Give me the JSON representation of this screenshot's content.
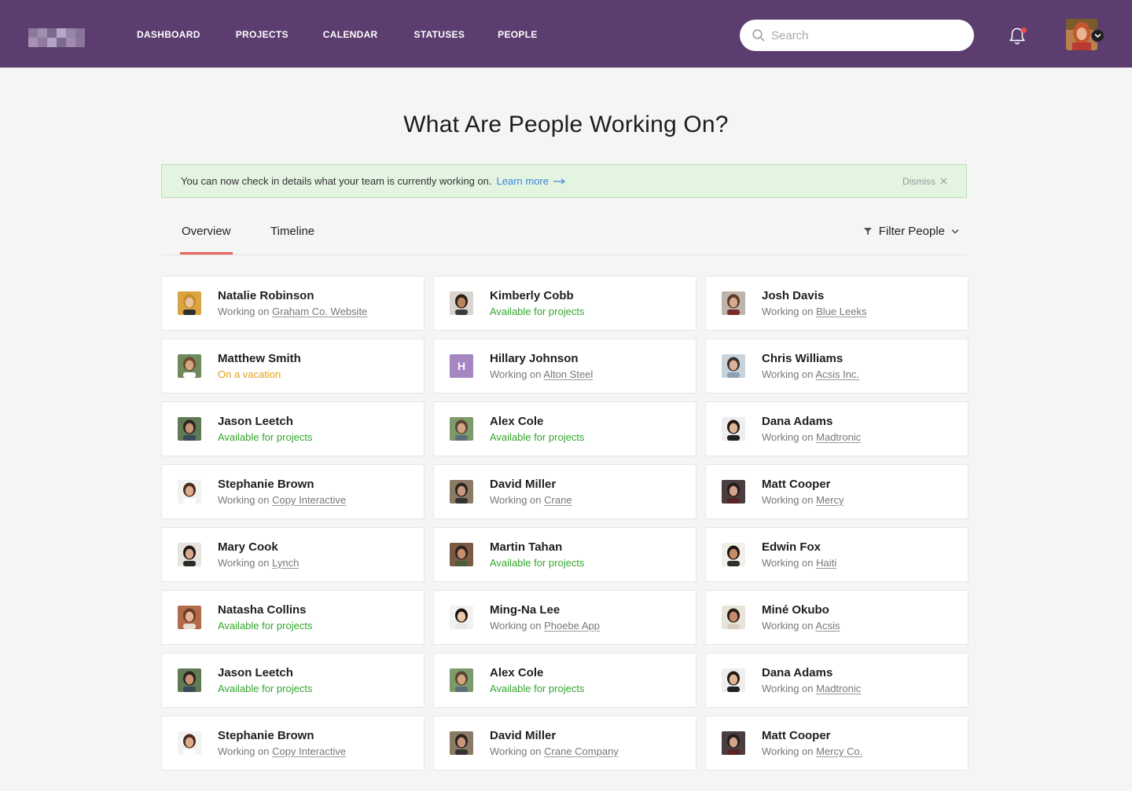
{
  "header": {
    "nav": [
      "DASHBOARD",
      "PROJECTS",
      "CALENDAR",
      "STATUSES",
      "PEOPLE"
    ],
    "search_placeholder": "Search",
    "brand_color": "#5b3d6f",
    "notification_dot_color": "#f04b4b"
  },
  "main": {
    "title": "What Are People Working On?",
    "banner": {
      "text": "You can now check in details what your team is currently working on.",
      "link": "Learn more",
      "dismiss": "Dismiss"
    },
    "tabs": [
      {
        "label": "Overview",
        "active": true
      },
      {
        "label": "Timeline",
        "active": false
      }
    ],
    "filter_label": "Filter People",
    "working_prefix": "Working on ",
    "people": [
      {
        "name": "Natalie Robinson",
        "status": "working",
        "project": "Graham Co. Website",
        "avatar": "photo-1"
      },
      {
        "name": "Kimberly Cobb",
        "status": "available",
        "text": "Available for projects",
        "avatar": "photo-2"
      },
      {
        "name": "Josh Davis",
        "status": "working",
        "project": "Blue Leeks",
        "avatar": "photo-3"
      },
      {
        "name": "Matthew Smith",
        "status": "vacation",
        "text": "On a vacation",
        "avatar": "photo-4"
      },
      {
        "name": "Hillary Johnson",
        "status": "working",
        "project": "Alton Steel",
        "avatar": "letter",
        "initial": "H"
      },
      {
        "name": "Chris Williams",
        "status": "working",
        "project": "Acsis Inc.",
        "avatar": "photo-5"
      },
      {
        "name": "Jason Leetch",
        "status": "available",
        "text": "Available for projects",
        "avatar": "photo-6"
      },
      {
        "name": "Alex Cole",
        "status": "available",
        "text": "Available for projects",
        "avatar": "photo-7"
      },
      {
        "name": "Dana Adams",
        "status": "working",
        "project": "Madtronic",
        "avatar": "photo-8"
      },
      {
        "name": "Stephanie Brown",
        "status": "working",
        "project": "Copy Interactive",
        "avatar": "photo-9"
      },
      {
        "name": "David Miller",
        "status": "working",
        "project": "Crane",
        "avatar": "photo-10"
      },
      {
        "name": "Matt Cooper",
        "status": "working",
        "project": "Mercy",
        "avatar": "photo-11"
      },
      {
        "name": "Mary Cook",
        "status": "working",
        "project": "Lynch",
        "avatar": "photo-12"
      },
      {
        "name": "Martin Tahan",
        "status": "available",
        "text": "Available for projects",
        "avatar": "photo-13"
      },
      {
        "name": "Edwin Fox",
        "status": "working",
        "project": "Haiti",
        "avatar": "photo-14"
      },
      {
        "name": "Natasha Collins",
        "status": "available",
        "text": "Available for projects",
        "avatar": "photo-15"
      },
      {
        "name": "Ming-Na Lee",
        "status": "working",
        "project": "Phoebe App",
        "avatar": "photo-16"
      },
      {
        "name": "Miné Okubo",
        "status": "working",
        "project": "Acsis",
        "avatar": "photo-17"
      },
      {
        "name": "Jason Leetch",
        "status": "available",
        "text": "Available for projects",
        "avatar": "photo-6"
      },
      {
        "name": "Alex Cole",
        "status": "available",
        "text": "Available for projects",
        "avatar": "photo-7"
      },
      {
        "name": "Dana Adams",
        "status": "working",
        "project": "Madtronic",
        "avatar": "photo-8"
      },
      {
        "name": "Stephanie Brown",
        "status": "working",
        "project": "Copy Interactive",
        "avatar": "photo-9"
      },
      {
        "name": "David Miller",
        "status": "working",
        "project": "Crane Company",
        "avatar": "photo-10"
      },
      {
        "name": "Matt Cooper",
        "status": "working",
        "project": "Mercy Co.",
        "avatar": "photo-11"
      }
    ]
  }
}
